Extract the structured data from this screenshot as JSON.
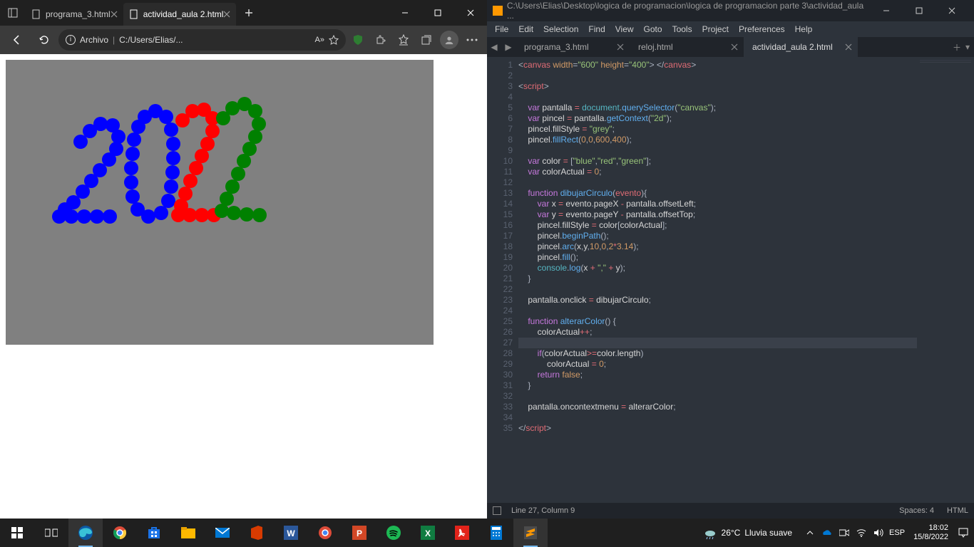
{
  "edge": {
    "tabs": [
      {
        "label": "programa_3.html"
      },
      {
        "label": "actividad_aula 2.html"
      }
    ],
    "url_prefix": "Archivo",
    "url_path": "C:/Users/Elias/...",
    "reader_badge": "A»"
  },
  "sublime": {
    "title_path": "C:\\Users\\Elias\\Desktop\\logica de programacion\\logica de programacion parte 3\\actividad_aula ...",
    "menus": [
      "File",
      "Edit",
      "Selection",
      "Find",
      "View",
      "Goto",
      "Tools",
      "Project",
      "Preferences",
      "Help"
    ],
    "tabs": [
      {
        "label": "programa_3.html"
      },
      {
        "label": "reloj.html"
      },
      {
        "label": "actividad_aula 2.html"
      }
    ],
    "status_left": "Line 27, Column 9",
    "status_spaces": "Spaces: 4",
    "status_lang": "HTML",
    "code_lines": 35,
    "highlight_line": 27,
    "modified_lines": [
      9,
      16,
      27,
      28,
      29
    ]
  },
  "taskbar": {
    "weather_temp": "26°C",
    "weather_text": "Lluvia suave",
    "lang": "ESP",
    "time": "18:02",
    "date": "15/8/2022"
  }
}
